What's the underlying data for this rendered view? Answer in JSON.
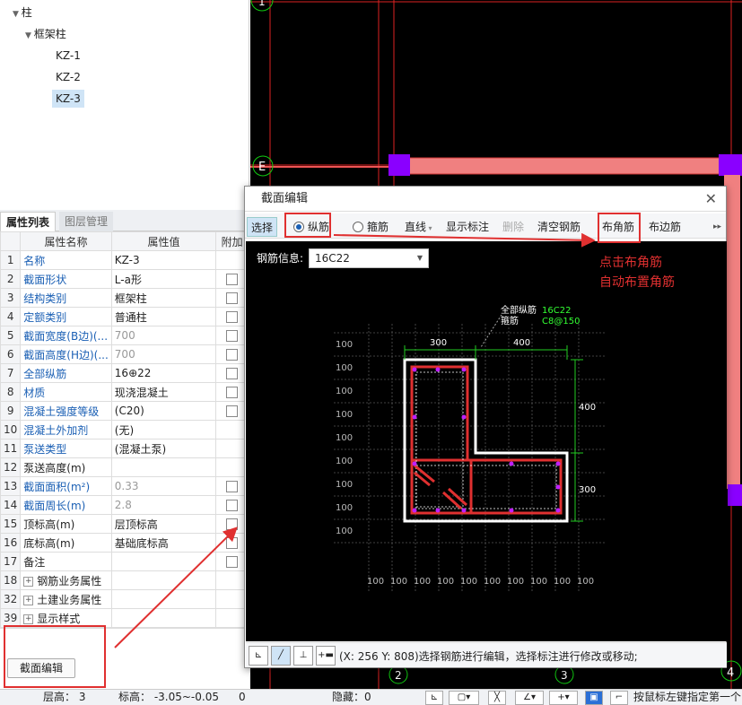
{
  "tree": {
    "root": "柱",
    "group": "框架柱",
    "items": [
      "KZ-1",
      "KZ-2",
      "KZ-3"
    ]
  },
  "canvas": {
    "axis_labels": {
      "top": "1",
      "left": "E",
      "b2": "2",
      "b3": "3",
      "b4": "4"
    }
  },
  "props": {
    "tabs": [
      "属性列表",
      "图层管理"
    ],
    "headers": {
      "name": "属性名称",
      "value": "属性值",
      "extra": "附加"
    },
    "rows": [
      {
        "n": "1",
        "name": "名称",
        "value": "KZ-3",
        "blue": true,
        "cb": false,
        "gray": false
      },
      {
        "n": "2",
        "name": "截面形状",
        "value": "L-a形",
        "blue": true,
        "cb": true,
        "gray": false
      },
      {
        "n": "3",
        "name": "结构类别",
        "value": "框架柱",
        "blue": true,
        "cb": true,
        "gray": false
      },
      {
        "n": "4",
        "name": "定额类别",
        "value": "普通柱",
        "blue": true,
        "cb": true,
        "gray": false
      },
      {
        "n": "5",
        "name": "截面宽度(B边)(...",
        "value": "700",
        "blue": true,
        "cb": true,
        "gray": true
      },
      {
        "n": "6",
        "name": "截面高度(H边)(...",
        "value": "700",
        "blue": true,
        "cb": true,
        "gray": true
      },
      {
        "n": "7",
        "name": "全部纵筋",
        "value": "16⊕22",
        "blue": true,
        "cb": true,
        "gray": false
      },
      {
        "n": "8",
        "name": "材质",
        "value": "现浇混凝土",
        "blue": true,
        "cb": true,
        "gray": false
      },
      {
        "n": "9",
        "name": "混凝土强度等级",
        "value": "(C20)",
        "blue": true,
        "cb": true,
        "gray": false
      },
      {
        "n": "10",
        "name": "混凝土外加剂",
        "value": "(无)",
        "blue": true,
        "cb": false,
        "gray": false
      },
      {
        "n": "11",
        "name": "泵送类型",
        "value": "(混凝土泵)",
        "blue": true,
        "cb": false,
        "gray": false
      },
      {
        "n": "12",
        "name": "泵送高度(m)",
        "value": "",
        "blue": false,
        "cb": false,
        "gray": false
      },
      {
        "n": "13",
        "name": "截面面积(m²)",
        "value": "0.33",
        "blue": true,
        "cb": true,
        "gray": true
      },
      {
        "n": "14",
        "name": "截面周长(m)",
        "value": "2.8",
        "blue": true,
        "cb": true,
        "gray": true
      },
      {
        "n": "15",
        "name": "顶标高(m)",
        "value": "层顶标高",
        "blue": false,
        "cb": true,
        "gray": false
      },
      {
        "n": "16",
        "name": "底标高(m)",
        "value": "基础底标高",
        "blue": false,
        "cb": true,
        "gray": false
      },
      {
        "n": "17",
        "name": "备注",
        "value": "",
        "blue": false,
        "cb": true,
        "gray": false
      },
      {
        "n": "18",
        "name": "钢筋业务属性",
        "value": "",
        "blue": false,
        "cb": false,
        "gray": false,
        "exp": true
      },
      {
        "n": "32",
        "name": "土建业务属性",
        "value": "",
        "blue": false,
        "cb": false,
        "gray": false,
        "exp": true
      },
      {
        "n": "39",
        "name": "显示样式",
        "value": "",
        "blue": false,
        "cb": false,
        "gray": false,
        "exp": true
      }
    ],
    "section_edit_button": "截面编辑"
  },
  "status": {
    "floor_height": "层高： 3",
    "elevation": "标高： -3.05~-0.05",
    "zero": "0",
    "hidden": "隐藏：0",
    "hint": "按鼠标左键指定第一个"
  },
  "dialog": {
    "title": "截面编辑",
    "toolbar": {
      "select": "选择",
      "longitudinal": "纵筋",
      "stirrup": "箍筋",
      "line": "直线",
      "show_dim": "显示标注",
      "delete": "删除",
      "clear": "清空钢筋",
      "corner": "布角筋",
      "edge": "布边筋"
    },
    "rebar_info_label": "钢筋信息:",
    "rebar_info_value": "16C22",
    "drawing": {
      "all_long": "全部纵筋",
      "long_val": "16C22",
      "stirrup": "箍筋",
      "stirrup_val": "C8@150",
      "dim_300_top": "300",
      "dim_400_top": "400",
      "dim_400_right": "400",
      "dim_300_right": "300",
      "grid": "100"
    },
    "bottom_hint": "(X: 256 Y: 808)选择钢筋进行编辑，选择标注进行修改或移动;"
  },
  "annotation": {
    "line1": "点击布角筋",
    "line2": "自动布置角筋"
  },
  "colors": {
    "accent": "#e03030",
    "rebar": "#ff3333",
    "stirrup_label": "#33ff33"
  }
}
